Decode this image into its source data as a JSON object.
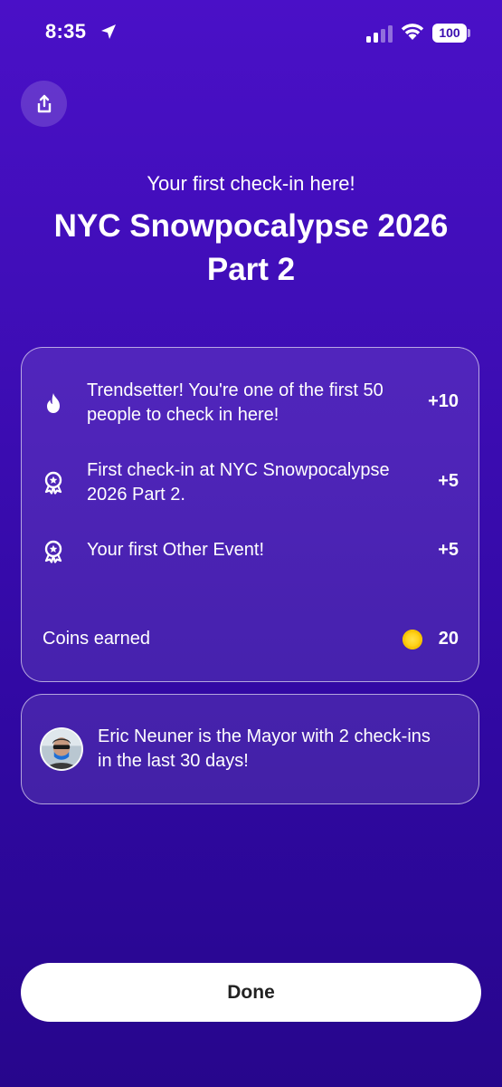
{
  "status_bar": {
    "time": "8:35",
    "battery": "100"
  },
  "header": {
    "subtitle": "Your first check-in here!",
    "title": "NYC Snowpocalypse 2026 Part 2"
  },
  "rewards": {
    "items": [
      {
        "icon": "flame-icon",
        "text": "Trendsetter! You're one of the first 50 people to check in here!",
        "points": "+10"
      },
      {
        "icon": "badge-ribbon-icon",
        "text": "First check-in at NYC Snowpocalypse 2026 Part 2.",
        "points": "+5"
      },
      {
        "icon": "badge-ribbon-icon",
        "text": "Your first Other Event!",
        "points": "+5"
      }
    ],
    "coins_label": "Coins earned",
    "coins_value": "20",
    "coin_color": "#FFD21A"
  },
  "mayor": {
    "text": "Eric Neuner is the Mayor with 2 check-ins in the last 30 days!"
  },
  "actions": {
    "done_label": "Done"
  },
  "colors": {
    "background_top": "#4A10C7",
    "background_bottom": "#27068C",
    "card_border": "#FFFFFF"
  }
}
